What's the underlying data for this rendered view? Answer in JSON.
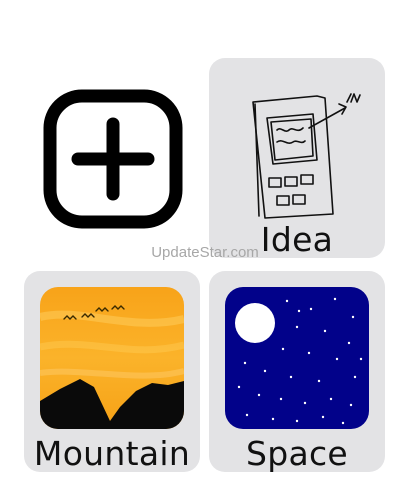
{
  "tiles": {
    "add": {
      "icon": "plus-square-icon"
    },
    "idea": {
      "label": "Idea",
      "image": "sketch-drawing-image"
    },
    "mountain": {
      "label": "Mountain",
      "image": "mountain-sunset-image"
    },
    "space": {
      "label": "Space",
      "image": "night-sky-moon-image"
    }
  },
  "watermark": "UpdateStar.com",
  "colors": {
    "tile_bg": "#e3e3e5",
    "sunset_orange": "#f7a51b",
    "mountain_black": "#0a0a0a",
    "night_navy": "#02028a",
    "moon_white": "#ffffff"
  }
}
